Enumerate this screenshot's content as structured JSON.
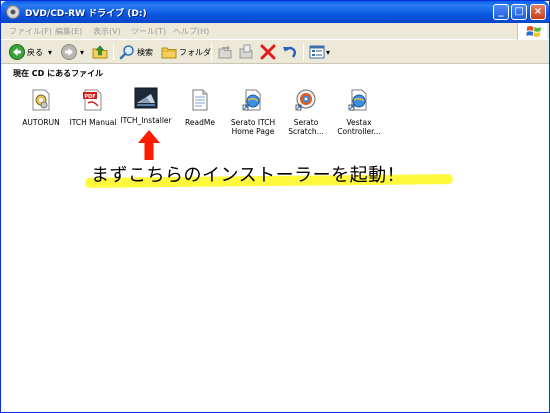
{
  "window": {
    "title": "DVD/CD-RW ドライブ (D:)",
    "colors": {
      "titlebar": "#0a5fe9",
      "chrome": "#ece9d8",
      "highlight": "#fff833",
      "arrow": "#ff1a00"
    }
  },
  "menu": [
    "ファイル(F)",
    "編集(E)",
    "表示(V)",
    "ツール(T)",
    "ヘルプ(H)"
  ],
  "toolbar": {
    "back_label": "戻る",
    "search_label": "検索",
    "folders_label": "フォルダ",
    "icons": [
      "back-arrow-icon",
      "forward-arrow-icon",
      "up-folder-icon",
      "search-icon",
      "folders-icon",
      "move-to-icon",
      "copy-to-icon",
      "delete-icon",
      "undo-icon",
      "views-icon"
    ]
  },
  "path": {
    "label": "現在 CD にあるファイル"
  },
  "files": [
    {
      "name": "AUTORUN",
      "icon": "autorun-settings-icon"
    },
    {
      "name": "ITCH Manual",
      "icon": "pdf-icon"
    },
    {
      "name": "ITCH_Installer",
      "icon": "installer-icon"
    },
    {
      "name": "ReadMe",
      "icon": "text-document-icon"
    },
    {
      "name": "Serato ITCH\nHome Page",
      "icon": "web-shortcut-icon"
    },
    {
      "name": "Serato\nScratch...",
      "icon": "disc-shortcut-icon"
    },
    {
      "name": "Vestax\nController...",
      "icon": "web-shortcut-icon"
    }
  ],
  "annotation": {
    "text": "まずこちらのインストーラーを起動！"
  }
}
